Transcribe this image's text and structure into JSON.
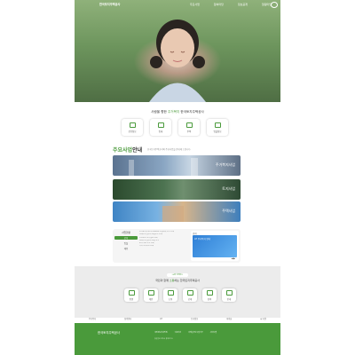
{
  "brand": {
    "logo": "한국토지주택공사",
    "accent": "#4a9a3b"
  },
  "nav": {
    "items": [
      "주요사업",
      "참여마당",
      "정보공개",
      "알림마당",
      "고객참여"
    ]
  },
  "slogan": {
    "prefix": "사람을 향한",
    "highlight": "주거복지",
    "suffix": "한국토지주택공사"
  },
  "quick_links": [
    "분양정보",
    "임대",
    "주택",
    "입찰정보"
  ],
  "business": {
    "title_green": "주요사업",
    "title_black": "안내",
    "subtitle": "한국토지주택공사의 주요사업을 안내해 드립니다.",
    "banners": [
      "주거복지사업",
      "토지사업",
      "주택사업"
    ]
  },
  "stats": {
    "header": "사업현황",
    "rows": [
      "공지",
      "입찰",
      "채용"
    ]
  },
  "notices": [
    "한국토지주택공사 2023년 사업계획 공고 안내",
    "임대주택 입주자 모집공고 안내",
    "공공분양 청약 일정 안내",
    "행복주택 입주자 모집 공고",
    "토지 공급 공고 안내",
    "기타 공지사항 안내"
  ],
  "card": {
    "header": "공지",
    "text": "LH 주거복지 안내",
    "pager": "◀ ▶"
  },
  "people": {
    "pill": "LH와 함께하는",
    "prefix": "국민과 함께",
    "highlight": "소통",
    "suffix": "하는 한국토지주택공사",
    "buttons": [
      "민원",
      "제안",
      "소통",
      "공개",
      "참여",
      "안내"
    ]
  },
  "partners": [
    "주거복지",
    "청약센터",
    "LH",
    "토지정보",
    "마이홈",
    "씨:리얼"
  ],
  "footer": {
    "title": "한국토지주택공사",
    "links": [
      "개인정보처리방침",
      "이용약관",
      "이메일무단수집거부",
      "사이트맵"
    ],
    "address": "경상남도 진주시 충의로 19"
  }
}
